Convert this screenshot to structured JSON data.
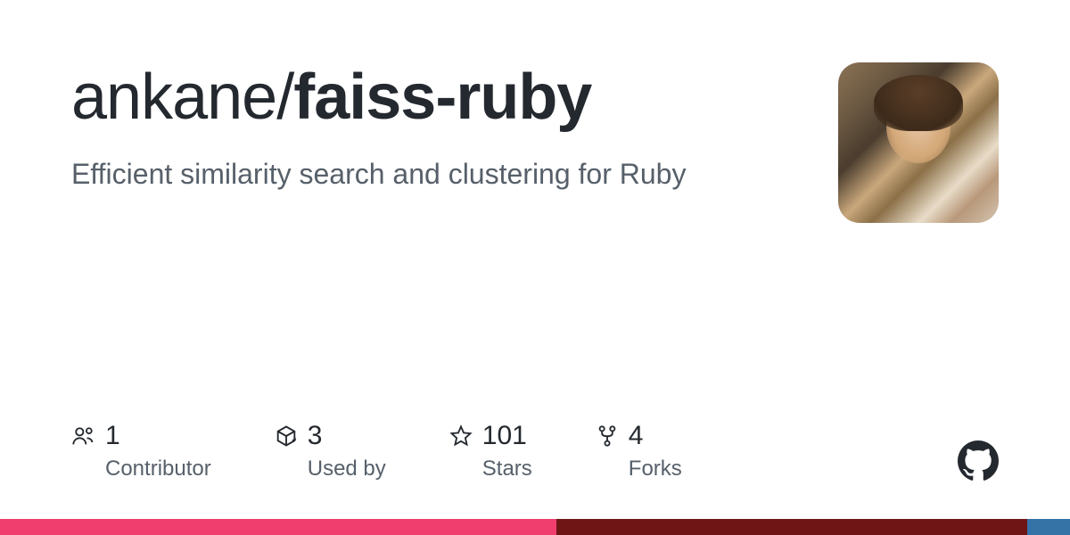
{
  "repo": {
    "owner": "ankane",
    "slash": "/",
    "name": "faiss-ruby",
    "description": "Efficient similarity search and clustering for Ruby"
  },
  "stats": {
    "contributors": {
      "value": "1",
      "label": "Contributor"
    },
    "usedby": {
      "value": "3",
      "label": "Used by"
    },
    "stars": {
      "value": "101",
      "label": "Stars"
    },
    "forks": {
      "value": "4",
      "label": "Forks"
    }
  },
  "languages": [
    {
      "color": "#f03e6f",
      "pct": 52
    },
    {
      "color": "#701516",
      "pct": 44
    },
    {
      "color": "#3572A5",
      "pct": 4
    }
  ]
}
